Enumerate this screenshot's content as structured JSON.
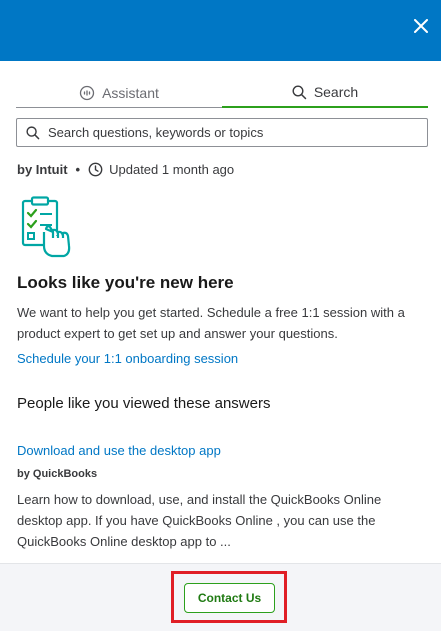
{
  "colors": {
    "header_blue": "#0077c5",
    "link_blue": "#0077c5",
    "accent_green": "#2ca01c",
    "highlight_red": "#e01f26",
    "illustration_teal": "#00a6a4"
  },
  "header": {
    "close_icon": "close-icon"
  },
  "tabs": [
    {
      "label": "Assistant",
      "icon": "chat-bubble-icon",
      "active": false
    },
    {
      "label": "Search",
      "icon": "search-icon",
      "active": true
    }
  ],
  "search": {
    "placeholder": "Search questions, keywords or topics",
    "icon": "search-icon"
  },
  "meta": {
    "author": "by Intuit",
    "separator": "•",
    "updated": "Updated 1 month ago",
    "icon": "clock-icon"
  },
  "welcome": {
    "illustration": "checklist-hand-icon",
    "heading": "Looks like you're new here",
    "body": "We want to help you get started. Schedule a free 1:1 session with a product expert to get set up and answer your questions.",
    "link": "Schedule your 1:1 onboarding session"
  },
  "answers": {
    "title": "People like you viewed these answers",
    "items": [
      {
        "title": "Download and use the desktop app",
        "source": "by QuickBooks",
        "snippet": "Learn how to download, use, and install the QuickBooks Online desktop app. If you have QuickBooks Online , you can use the QuickBooks Online desktop app to ..."
      }
    ]
  },
  "footer": {
    "contact_label": "Contact Us"
  }
}
